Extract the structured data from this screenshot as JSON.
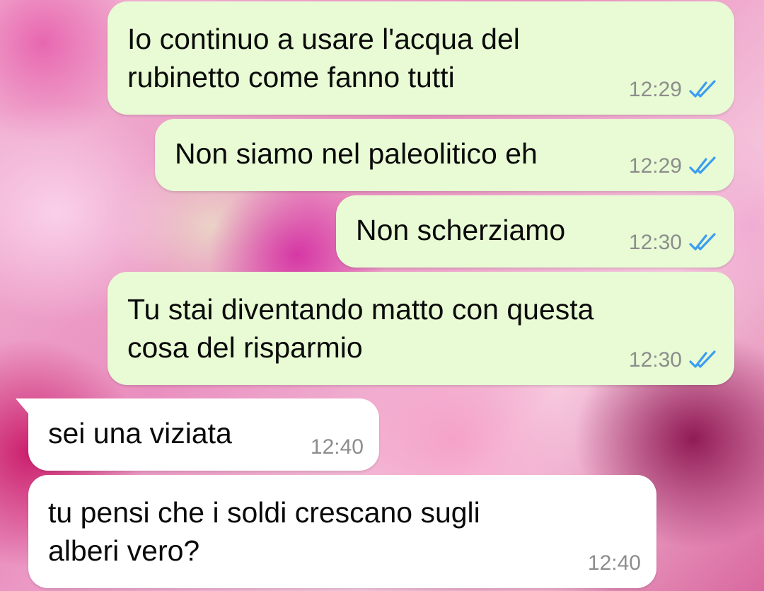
{
  "colors": {
    "outgoing_bubble": "#e8fbd4",
    "incoming_bubble": "#ffffff",
    "read_ticks": "#3b9df0",
    "time_text": "#8d8d8d"
  },
  "messages": [
    {
      "direction": "outgoing",
      "text": "Io continuo a usare l'acqua del\nrubinetto come fanno tutti",
      "time": "12:29",
      "status_icon": "double-check-read-icon"
    },
    {
      "direction": "outgoing",
      "text": "Non siamo nel paleolitico eh",
      "time": "12:29",
      "status_icon": "double-check-read-icon"
    },
    {
      "direction": "outgoing",
      "text": "Non scherziamo",
      "time": "12:30",
      "status_icon": "double-check-read-icon"
    },
    {
      "direction": "outgoing",
      "text": "Tu stai diventando matto con questa\ncosa del risparmio",
      "time": "12:30",
      "status_icon": "double-check-read-icon"
    },
    {
      "direction": "incoming",
      "text": "sei una viziata",
      "time": "12:40"
    },
    {
      "direction": "incoming",
      "text": "tu pensi che i soldi crescano sugli\nalberi vero?",
      "time": "12:40"
    }
  ]
}
